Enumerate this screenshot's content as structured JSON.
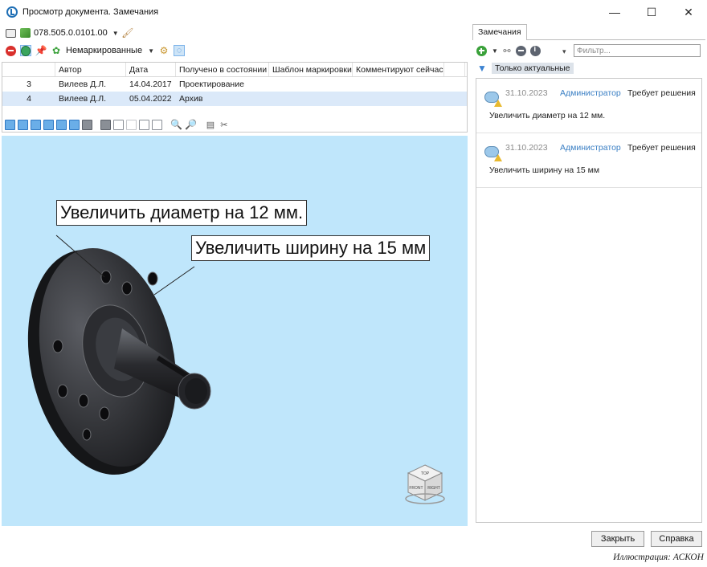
{
  "window": {
    "title": "Просмотр документа. Замечания",
    "minimize_glyph": "—",
    "maximize_glyph": "☐",
    "close_glyph": "✕"
  },
  "toolbar": {
    "document_code": "078.505.0.0101.00",
    "marking_filter": "Немаркированные"
  },
  "versions_table": {
    "columns": [
      "",
      "Автор",
      "Дата",
      "Получено в состоянии",
      "Шаблон маркировки",
      "Комментируют сейчас"
    ],
    "rows": [
      {
        "num": "3",
        "author": "Вилеев Д.Л.",
        "date": "14.04.2017",
        "state": "Проектирование"
      },
      {
        "num": "4",
        "author": "Вилеев Д.Л.",
        "date": "05.04.2022",
        "state": "Архив"
      }
    ],
    "selected_row": 2
  },
  "viewport": {
    "callout1": "Увеличить диаметр на 12 мм.",
    "callout2": "Увеличить ширину на 15 мм",
    "background_color": "#bfe6fb",
    "model_color": "#2e2f33",
    "navcube_faces": {
      "top": "TOP",
      "front": "FRONT",
      "right": "RIGHT"
    }
  },
  "remarks_panel": {
    "tab_label": "Замечания",
    "filter_placeholder": "Фильтр...",
    "only_actual_label": "Только актуальные",
    "items": [
      {
        "date": "31.10.2023",
        "author": "Администратор",
        "status": "Требует решения",
        "text": "Увеличить диаметр на 12 мм."
      },
      {
        "date": "31.10.2023",
        "author": "Администратор",
        "status": "Требует решения",
        "text": "Увеличить ширину на 15 мм"
      }
    ]
  },
  "buttons": {
    "close": "Закрыть",
    "help": "Справка"
  },
  "caption": "Иллюстрация: АСКОН"
}
